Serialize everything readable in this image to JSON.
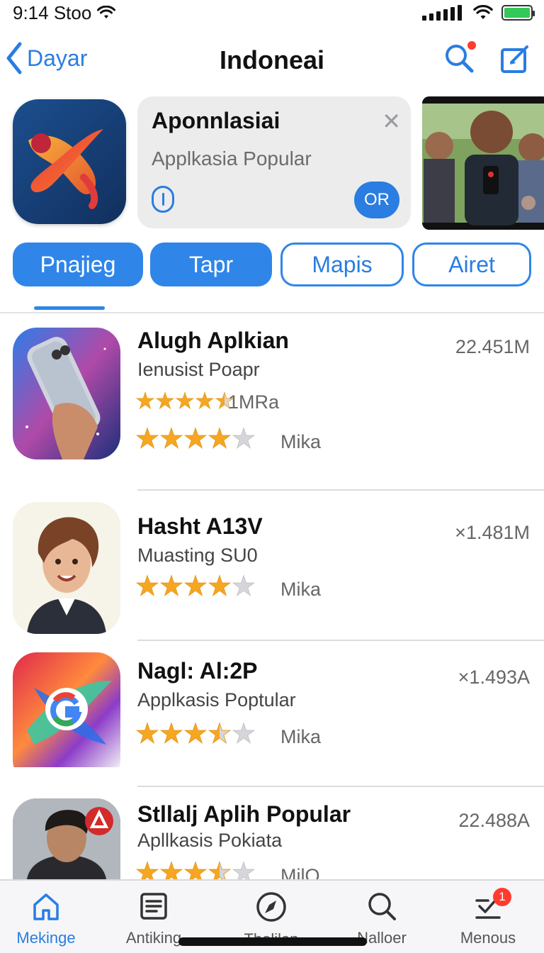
{
  "status": {
    "time": "9:14 Stoo"
  },
  "nav": {
    "back_label": "Dayar",
    "title": "Indoneai"
  },
  "featured": {
    "card_title": "Aponnlasiai",
    "card_subtitle": "Applkasia Popular",
    "get_label": "OR"
  },
  "filters": [
    {
      "label": "Pnajieg",
      "active": true
    },
    {
      "label": "Tapr",
      "active": true
    },
    {
      "label": "Mapis",
      "active": false
    },
    {
      "label": "Airet",
      "active": false
    }
  ],
  "apps": [
    {
      "name": "Alugh Aplkian",
      "subtitle": "Ienusist Poapr",
      "size": "22.451M",
      "rating_label_1": "1MRa",
      "rating_label_2": "Mika",
      "rating_1": 4.5,
      "rating_2": 4.0
    },
    {
      "name": "Hasht A13V",
      "subtitle": "Muasting SU0",
      "size": "×1.481M",
      "rating_label_2": "Mika",
      "rating_2": 4.0
    },
    {
      "name": "Nagl: Al:2P",
      "subtitle": "Applkasis Poptular",
      "size": "×1.493A",
      "rating_label_2": "Mika",
      "rating_2": 3.5
    },
    {
      "name": "Stllalj Aplih Popular",
      "subtitle": "Apllkasis Pokiata",
      "size": "22.488A",
      "rating_label_2": "MilQ",
      "rating_2": 3.5
    }
  ],
  "tabs": [
    {
      "label": "Mekinge",
      "icon": "home-icon",
      "active": true
    },
    {
      "label": "Antiking",
      "icon": "list-icon",
      "active": false
    },
    {
      "label": "Tholilon",
      "icon": "compass-icon",
      "active": false
    },
    {
      "label": "Nalloer",
      "icon": "search-icon",
      "active": false
    },
    {
      "label": "Menous",
      "icon": "updates-icon",
      "active": false,
      "badge": "1"
    }
  ],
  "colors": {
    "accent": "#2a7de1",
    "badge": "#ff3b30",
    "star": "#f5a623"
  }
}
